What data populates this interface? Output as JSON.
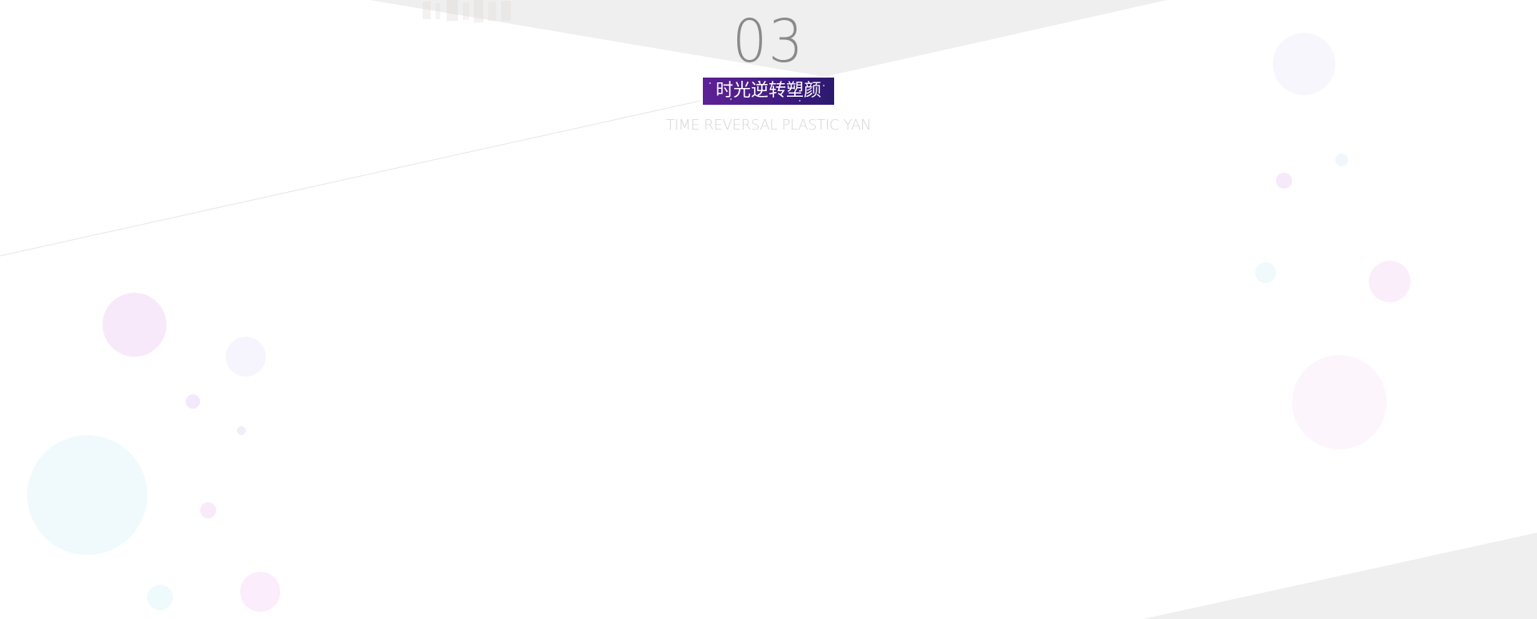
{
  "section": {
    "number": "03",
    "title": "时光逆转塑颜",
    "subtitle": "TIME REVERSAL PLASTIC YAN"
  },
  "colors": {
    "background": "#ffffff",
    "band_gray": "#efefef",
    "number_gray": "#8a8a8a",
    "badge_purple": "#4a1f86",
    "subtitle_gray": "#d4d4d4",
    "bubble_pink": "#f7e8fa",
    "bubble_cyan": "#eefafc",
    "bubble_lavender": "#f5f4fc"
  }
}
